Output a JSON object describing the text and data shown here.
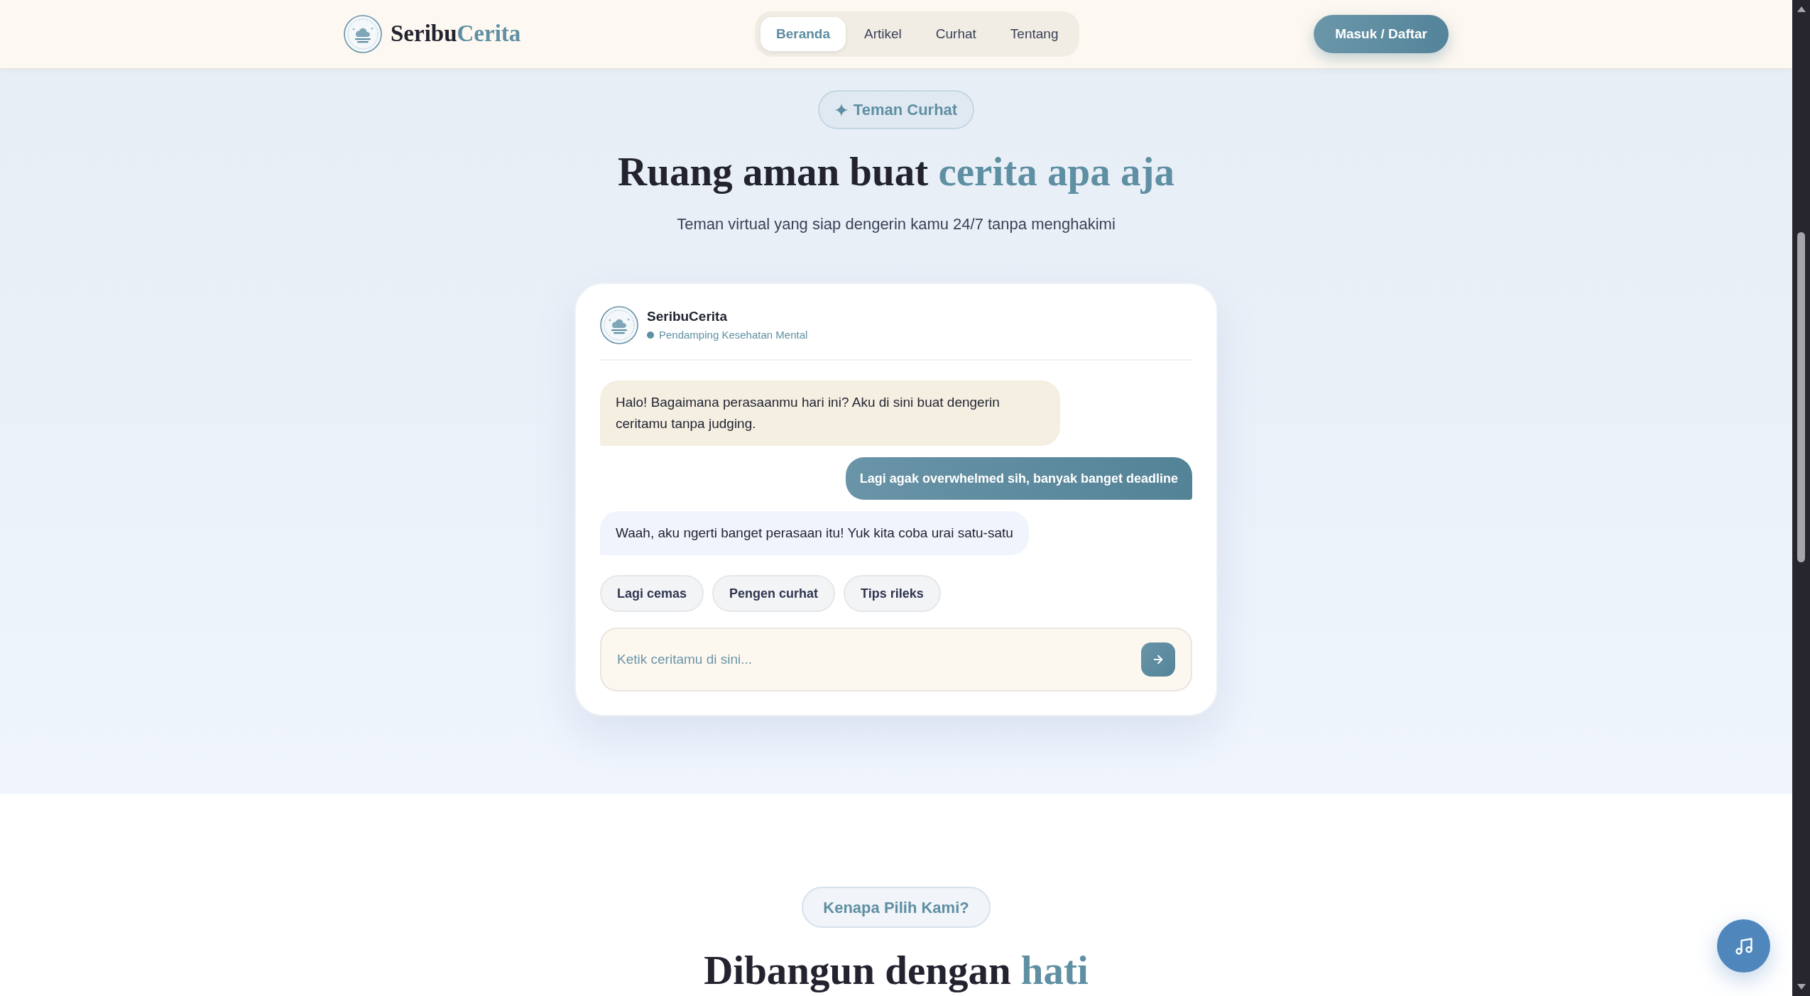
{
  "header": {
    "brand": {
      "name": "Seribu",
      "accent": "Cerita"
    },
    "nav": [
      {
        "label": "Beranda",
        "selected": true
      },
      {
        "label": "Artikel",
        "selected": false
      },
      {
        "label": "Curhat",
        "selected": false
      },
      {
        "label": "Tentang",
        "selected": false
      }
    ],
    "login_button": "Masuk / Daftar"
  },
  "hero": {
    "badge": "Teman Curhat",
    "heading": {
      "text": "Ruang aman buat",
      "accent": "cerita apa aja"
    },
    "subtitle": "Teman virtual yang siap dengerin kamu 24/7 tanpa menghakimi"
  },
  "chat": {
    "name": "SeribuCerita",
    "status": "Pendamping Kesehatan Mental",
    "messages": [
      {
        "kind": "bot",
        "color": "#f5efe2",
        "text": "Halo! Bagaimana perasaanmu hari ini? Aku di sini buat dengerin ceritamu tanpa judging."
      },
      {
        "kind": "user",
        "text": "Lagi agak overwhelmed sih, banyak banget deadline"
      },
      {
        "kind": "bot",
        "color": "#f0f4fd",
        "text": "Waah, aku ngerti banget perasaan itu! Yuk kita coba urai satu-satu"
      }
    ],
    "quick_replies": [
      "Lagi cemas",
      "Pengen curhat",
      "Tips rileks"
    ],
    "input": {
      "placeholder": "Ketik ceritamu di sini..."
    }
  },
  "features": {
    "badge": "Kenapa Pilih Kami?",
    "heading": {
      "text": "Dibangun dengan",
      "accent": "hati"
    }
  }
}
